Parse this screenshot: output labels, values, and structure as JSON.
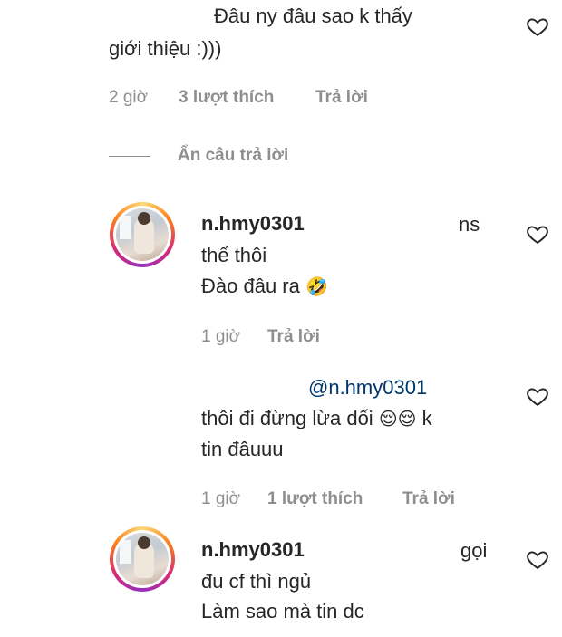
{
  "comment_top": {
    "line1": "Đâu ny đâu sao k thấy",
    "line2": "giới thiệu :)))",
    "time": "2 giờ",
    "likes": "3 lượt thích",
    "reply": "Trả lời"
  },
  "hide_replies": "Ẩn câu trả lời",
  "reply1": {
    "username": "n.hmy0301",
    "text_end": "ns",
    "line2": "thế thôi",
    "line3": "Đào đâu ra",
    "emoji": "🤣",
    "time": "1 giờ",
    "reply": "Trả lời"
  },
  "reply2": {
    "mention": "@n.hmy0301",
    "line1": "thôi đi đừng lừa dối",
    "emoji": "😌😌",
    "line1_end": "k",
    "line2": "tin đâuuu",
    "time": "1 giờ",
    "likes": "1 lượt thích",
    "reply": "Trả lời"
  },
  "reply3": {
    "username": "n.hmy0301",
    "text_end": "gọi",
    "line2": "đu cf thì ngủ",
    "line3": "Làm sao mà tin dc"
  },
  "icons": {
    "heart": "heart-outline-icon"
  }
}
